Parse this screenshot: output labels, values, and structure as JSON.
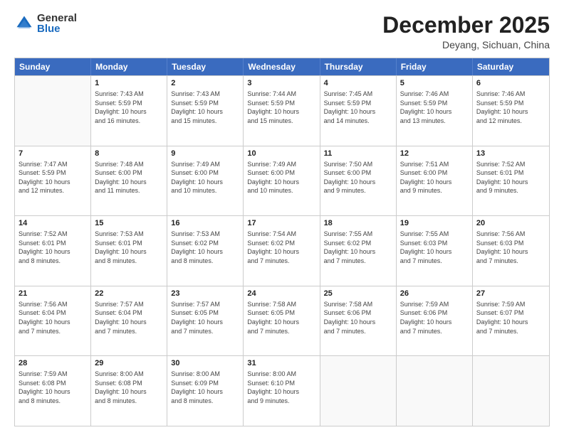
{
  "logo": {
    "general": "General",
    "blue": "Blue"
  },
  "title": "December 2025",
  "location": "Deyang, Sichuan, China",
  "days_header": [
    "Sunday",
    "Monday",
    "Tuesday",
    "Wednesday",
    "Thursday",
    "Friday",
    "Saturday"
  ],
  "rows": [
    [
      {
        "day": "",
        "info": "",
        "empty": true
      },
      {
        "day": "1",
        "info": "Sunrise: 7:43 AM\nSunset: 5:59 PM\nDaylight: 10 hours\nand 16 minutes."
      },
      {
        "day": "2",
        "info": "Sunrise: 7:43 AM\nSunset: 5:59 PM\nDaylight: 10 hours\nand 15 minutes."
      },
      {
        "day": "3",
        "info": "Sunrise: 7:44 AM\nSunset: 5:59 PM\nDaylight: 10 hours\nand 15 minutes."
      },
      {
        "day": "4",
        "info": "Sunrise: 7:45 AM\nSunset: 5:59 PM\nDaylight: 10 hours\nand 14 minutes."
      },
      {
        "day": "5",
        "info": "Sunrise: 7:46 AM\nSunset: 5:59 PM\nDaylight: 10 hours\nand 13 minutes."
      },
      {
        "day": "6",
        "info": "Sunrise: 7:46 AM\nSunset: 5:59 PM\nDaylight: 10 hours\nand 12 minutes."
      }
    ],
    [
      {
        "day": "7",
        "info": "Sunrise: 7:47 AM\nSunset: 5:59 PM\nDaylight: 10 hours\nand 12 minutes."
      },
      {
        "day": "8",
        "info": "Sunrise: 7:48 AM\nSunset: 6:00 PM\nDaylight: 10 hours\nand 11 minutes."
      },
      {
        "day": "9",
        "info": "Sunrise: 7:49 AM\nSunset: 6:00 PM\nDaylight: 10 hours\nand 10 minutes."
      },
      {
        "day": "10",
        "info": "Sunrise: 7:49 AM\nSunset: 6:00 PM\nDaylight: 10 hours\nand 10 minutes."
      },
      {
        "day": "11",
        "info": "Sunrise: 7:50 AM\nSunset: 6:00 PM\nDaylight: 10 hours\nand 9 minutes."
      },
      {
        "day": "12",
        "info": "Sunrise: 7:51 AM\nSunset: 6:00 PM\nDaylight: 10 hours\nand 9 minutes."
      },
      {
        "day": "13",
        "info": "Sunrise: 7:52 AM\nSunset: 6:01 PM\nDaylight: 10 hours\nand 9 minutes."
      }
    ],
    [
      {
        "day": "14",
        "info": "Sunrise: 7:52 AM\nSunset: 6:01 PM\nDaylight: 10 hours\nand 8 minutes."
      },
      {
        "day": "15",
        "info": "Sunrise: 7:53 AM\nSunset: 6:01 PM\nDaylight: 10 hours\nand 8 minutes."
      },
      {
        "day": "16",
        "info": "Sunrise: 7:53 AM\nSunset: 6:02 PM\nDaylight: 10 hours\nand 8 minutes."
      },
      {
        "day": "17",
        "info": "Sunrise: 7:54 AM\nSunset: 6:02 PM\nDaylight: 10 hours\nand 7 minutes."
      },
      {
        "day": "18",
        "info": "Sunrise: 7:55 AM\nSunset: 6:02 PM\nDaylight: 10 hours\nand 7 minutes."
      },
      {
        "day": "19",
        "info": "Sunrise: 7:55 AM\nSunset: 6:03 PM\nDaylight: 10 hours\nand 7 minutes."
      },
      {
        "day": "20",
        "info": "Sunrise: 7:56 AM\nSunset: 6:03 PM\nDaylight: 10 hours\nand 7 minutes."
      }
    ],
    [
      {
        "day": "21",
        "info": "Sunrise: 7:56 AM\nSunset: 6:04 PM\nDaylight: 10 hours\nand 7 minutes."
      },
      {
        "day": "22",
        "info": "Sunrise: 7:57 AM\nSunset: 6:04 PM\nDaylight: 10 hours\nand 7 minutes."
      },
      {
        "day": "23",
        "info": "Sunrise: 7:57 AM\nSunset: 6:05 PM\nDaylight: 10 hours\nand 7 minutes."
      },
      {
        "day": "24",
        "info": "Sunrise: 7:58 AM\nSunset: 6:05 PM\nDaylight: 10 hours\nand 7 minutes."
      },
      {
        "day": "25",
        "info": "Sunrise: 7:58 AM\nSunset: 6:06 PM\nDaylight: 10 hours\nand 7 minutes."
      },
      {
        "day": "26",
        "info": "Sunrise: 7:59 AM\nSunset: 6:06 PM\nDaylight: 10 hours\nand 7 minutes."
      },
      {
        "day": "27",
        "info": "Sunrise: 7:59 AM\nSunset: 6:07 PM\nDaylight: 10 hours\nand 7 minutes."
      }
    ],
    [
      {
        "day": "28",
        "info": "Sunrise: 7:59 AM\nSunset: 6:08 PM\nDaylight: 10 hours\nand 8 minutes."
      },
      {
        "day": "29",
        "info": "Sunrise: 8:00 AM\nSunset: 6:08 PM\nDaylight: 10 hours\nand 8 minutes."
      },
      {
        "day": "30",
        "info": "Sunrise: 8:00 AM\nSunset: 6:09 PM\nDaylight: 10 hours\nand 8 minutes."
      },
      {
        "day": "31",
        "info": "Sunrise: 8:00 AM\nSunset: 6:10 PM\nDaylight: 10 hours\nand 9 minutes."
      },
      {
        "day": "",
        "info": "",
        "empty": true
      },
      {
        "day": "",
        "info": "",
        "empty": true
      },
      {
        "day": "",
        "info": "",
        "empty": true
      }
    ]
  ]
}
